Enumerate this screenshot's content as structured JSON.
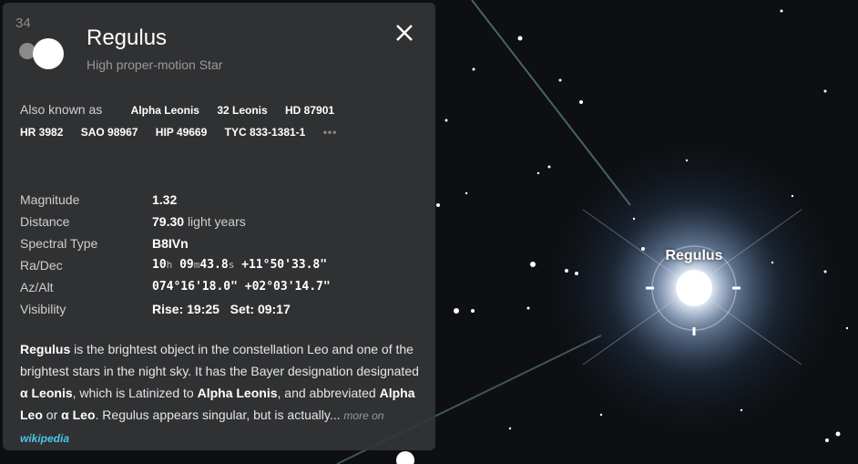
{
  "star": {
    "name": "Regulus",
    "type": "High proper-motion Star",
    "corner_number": "34"
  },
  "sky_label": "Regulus",
  "aka": {
    "label": "Also known as",
    "names": [
      "Alpha Leonis",
      "32 Leonis",
      "HD 87901",
      "HR 3982",
      "SAO 98967",
      "HIP 49669",
      "TYC 833-1381-1"
    ],
    "more": "•••"
  },
  "props": {
    "magnitude_label": "Magnitude",
    "magnitude": "1.32",
    "distance_label": "Distance",
    "distance_value": "79.30",
    "distance_unit": "light years",
    "spectral_label": "Spectral Type",
    "spectral": "B8IVn",
    "radec_label": "Ra/Dec",
    "ra_h": "10",
    "ra_h_u": "h",
    "ra_m": "09",
    "ra_m_u": "m",
    "ra_s": "43.8",
    "ra_s_u": "s",
    "dec": "+11°50'33.8\"",
    "azalt_label": "Az/Alt",
    "az": "074°16'18.0\"",
    "alt": "+02°03'14.7\"",
    "visibility_label": "Visibility",
    "rise": "Rise: 19:25",
    "set": "Set: 09:17"
  },
  "description": {
    "name": "Regulus",
    "t1": " is the brightest object in the constellation Leo and one of the brightest stars in the night sky. It has the Bayer designation designated ",
    "b1": "α Leonis",
    "t2": ", which is Latinized to ",
    "b2": "Alpha Leonis",
    "t3": ", and abbreviated ",
    "b3": "Alpha Leo",
    "t4": " or ",
    "b4": "α Leo",
    "t5": ". Regulus appears singular, but is actually... ",
    "more_on": "more on ",
    "wiki": "wikipedia"
  },
  "colors": {
    "panel_bg": "#343537",
    "link": "#4fc3e8",
    "sky": "#0d0f12"
  },
  "icons": {
    "close": "close-icon",
    "moon": "moon-icon",
    "more": "more-icon"
  }
}
